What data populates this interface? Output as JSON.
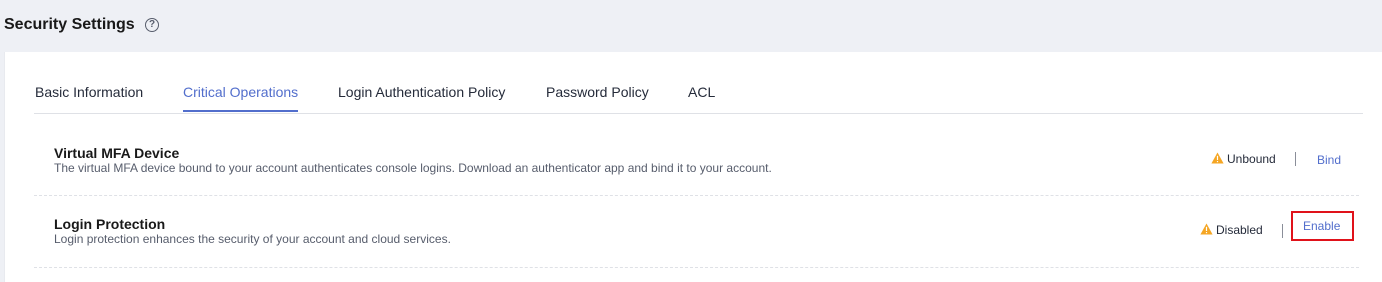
{
  "header": {
    "title": "Security Settings",
    "help_glyph": "?"
  },
  "tabs": [
    {
      "label": "Basic Information",
      "active": false
    },
    {
      "label": "Critical Operations",
      "active": true
    },
    {
      "label": "Login Authentication Policy",
      "active": false
    },
    {
      "label": "Password Policy",
      "active": false
    },
    {
      "label": "ACL",
      "active": false
    }
  ],
  "operations": [
    {
      "title": "Virtual MFA Device",
      "description": "The virtual MFA device bound to your account authenticates console logins. Download an authenticator app and bind it to your account.",
      "status": "Unbound",
      "status_icon": "warning-icon",
      "action": "Bind"
    },
    {
      "title": "Login Protection",
      "description": "Login protection enhances the security of your account and cloud services.",
      "status": "Disabled",
      "status_icon": "warning-icon",
      "action": "Enable"
    }
  ],
  "colors": {
    "accent": "#526ecc",
    "warning": "#f5a623",
    "highlight": "#e0121a",
    "background": "#eef0f5"
  }
}
